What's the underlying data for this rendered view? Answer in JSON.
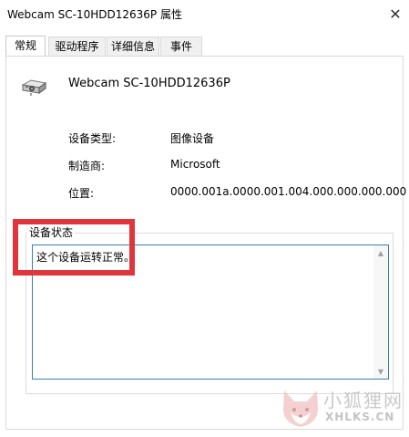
{
  "window": {
    "title": "Webcam SC-10HDD12636P 属性",
    "close_glyph": "✕"
  },
  "tabs": [
    {
      "label": "常规",
      "active": true
    },
    {
      "label": "驱动程序",
      "active": false
    },
    {
      "label": "详细信息",
      "active": false
    },
    {
      "label": "事件",
      "active": false
    }
  ],
  "device": {
    "name": "Webcam SC-10HDD12636P",
    "icon": "webcam-icon"
  },
  "properties": [
    {
      "label": "设备类型:",
      "value": "图像设备"
    },
    {
      "label": "制造商:",
      "value": "Microsoft"
    },
    {
      "label": "位置:",
      "value": "0000.001a.0000.001.004.000.000.000.000"
    }
  ],
  "status": {
    "group_title": "设备状态",
    "text": "这个设备运转正常。"
  },
  "watermark": {
    "cn": "小狐狸网",
    "en": "XHLKS.CN"
  },
  "colors": {
    "highlight": "#e0353a",
    "status_border": "#3c7fb1"
  }
}
